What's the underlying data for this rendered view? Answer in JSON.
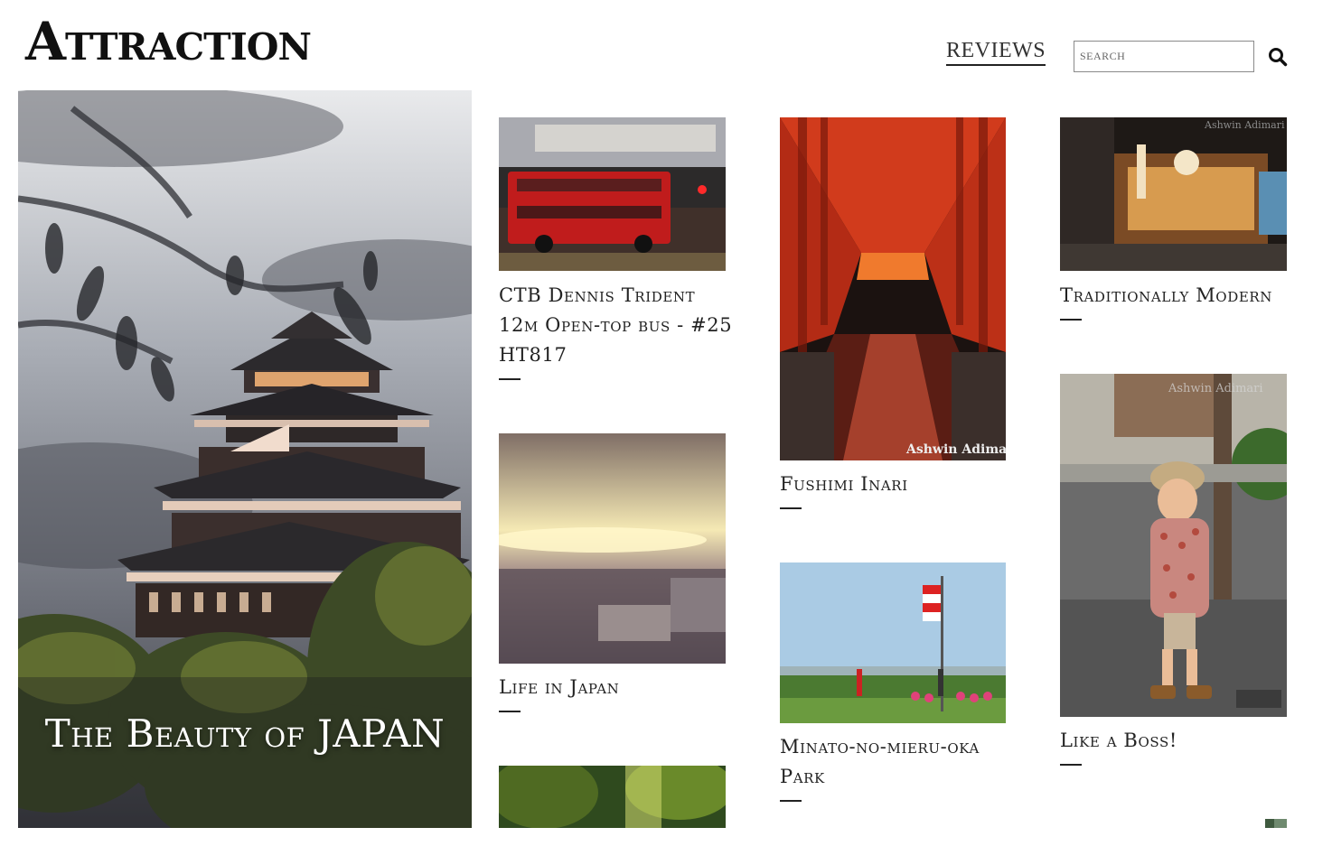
{
  "site": {
    "logo": "Attraction"
  },
  "nav": {
    "reviews": "REVIEWS"
  },
  "search": {
    "placeholder": "SEARCH"
  },
  "hero": {
    "title": "The Beauty of JAPAN"
  },
  "cards": [
    {
      "title": "CTB Dennis Trident 12m Open-top bus - #25 HT817"
    },
    {
      "title": "Life in Japan"
    },
    {
      "title": "Fushimi Inari"
    },
    {
      "title": "Minato-no-mieru-oka Park"
    },
    {
      "title": "Traditionally Modern"
    },
    {
      "title": "Like a Boss!"
    }
  ],
  "watermarks": {
    "fushimi": "Ashwin Adimari",
    "modern": "Ashwin Adimari",
    "boss": "Ashwin Adimari"
  },
  "colors": {
    "text": "#111111",
    "torii": "#c8361e",
    "hero_sky": "#b8bcc2"
  }
}
